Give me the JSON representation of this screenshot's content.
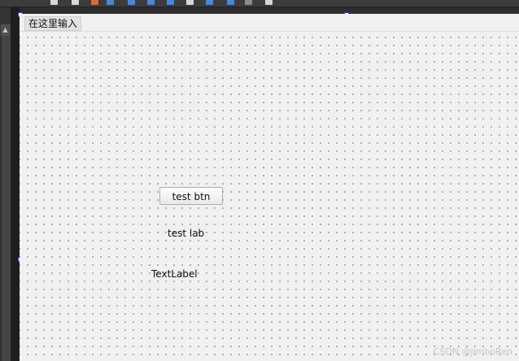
{
  "menubar": {
    "type_here_placeholder": "在这里输入"
  },
  "widgets": {
    "button_label": "test btn",
    "label_1": "test lab",
    "label_2": "TextLabel"
  },
  "watermark": "CSDN @jimboRen",
  "colors": {
    "canvas_bg": "#f0f0f0",
    "grid_dot": "#9a9a9a",
    "selection_handle": "#1f3fb8",
    "ide_dark": "#2d2d30"
  }
}
